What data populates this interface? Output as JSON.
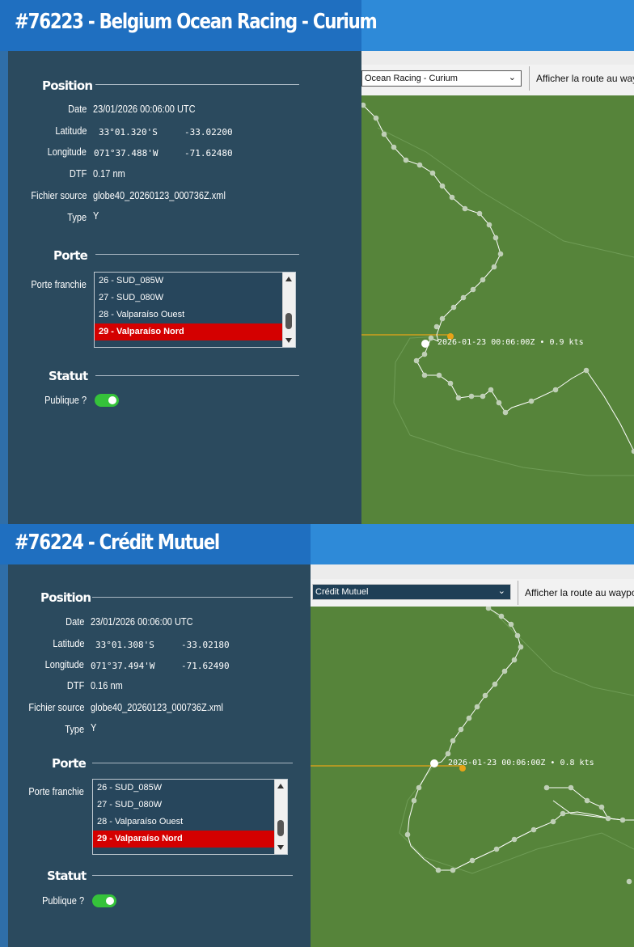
{
  "screens": [
    {
      "title": "#76223 - Belgium Ocean Racing - Curium",
      "boat_select": "Ocean Racing - Curium",
      "route_button": "Afficher la route au way",
      "position_heading": "Position",
      "date_label": "Date",
      "date_value": "23/01/2026 00:06:00 UTC",
      "lat_label": "Latitude",
      "lat_dms": "33°01.320'S",
      "lat_dec": "-33.02200",
      "lon_label": "Longitude",
      "lon_dms": "071°37.488'W",
      "lon_dec": "-71.62480",
      "dtf_label": "DTF",
      "dtf_value": "0.17 nm",
      "file_label": "Fichier source",
      "file_value": "globe40_20260123_000736Z.xml",
      "type_label": "Type",
      "type_value": "Y",
      "gate_heading": "Porte",
      "gate_label": "Porte franchie",
      "gates": [
        "26 - SUD_085W",
        "27 - SUD_080W",
        "28 - Valparaíso Ouest",
        "29 - Valparaíso Nord"
      ],
      "status_heading": "Statut",
      "public_label": "Publique ?",
      "map_label": "2026-01-23 00:06:00Z • 0.9 kts"
    },
    {
      "title": "#76224 - Crédit Mutuel",
      "boat_select": "Crédit Mutuel",
      "route_button": "Afficher la route au waypoi",
      "position_heading": "Position",
      "date_label": "Date",
      "date_value": "23/01/2026 00:06:00 UTC",
      "lat_label": "Latitude",
      "lat_dms": "33°01.308'S",
      "lat_dec": "-33.02180",
      "lon_label": "Longitude",
      "lon_dms": "071°37.494'W",
      "lon_dec": "-71.62490",
      "dtf_label": "DTF",
      "dtf_value": "0.16 nm",
      "file_label": "Fichier source",
      "file_value": "globe40_20260123_000736Z.xml",
      "type_label": "Type",
      "type_value": "Y",
      "gate_heading": "Porte",
      "gate_label": "Porte franchie",
      "gates": [
        "26 - SUD_085W",
        "27 - SUD_080W",
        "28 - Valparaíso Ouest",
        "29 - Valparaíso Nord"
      ],
      "status_heading": "Statut",
      "public_label": "Publique ?",
      "map_label": "2026-01-23 00:06:00Z • 0.8 kts"
    }
  ],
  "colors": {
    "accent": "#2e8ad8",
    "panel": "#2b4a5e",
    "map": "#56843a",
    "selected_gate": "#d40000",
    "toggle_on": "#35c23a",
    "gate_line": "#e8a317"
  },
  "public_enabled": true
}
